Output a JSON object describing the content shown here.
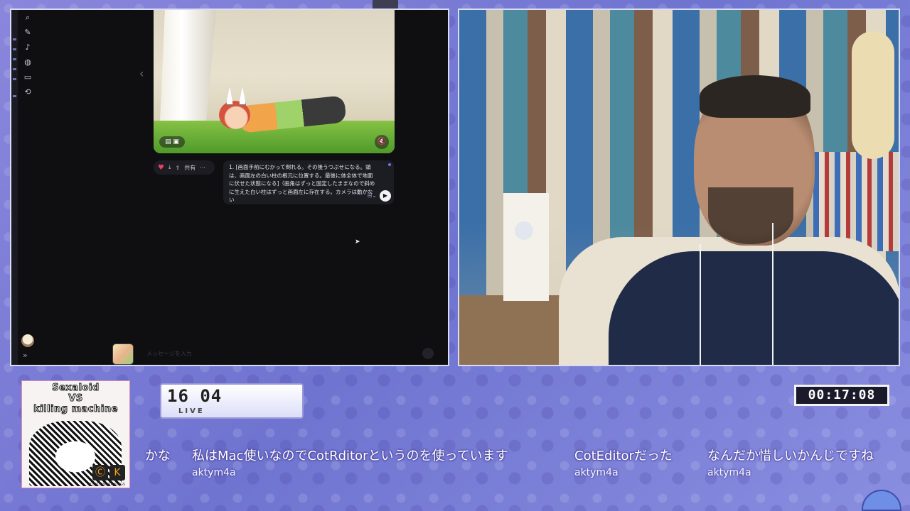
{
  "screen": {
    "rail_icons": [
      "search-icon",
      "edit-icon",
      "audio-icon",
      "globe-icon",
      "folder-icon",
      "history-icon"
    ],
    "rail_glyphs": [
      "⌕",
      "✎",
      "♪",
      "◍",
      "▭",
      "⟲"
    ],
    "prev_arrow": "‹",
    "expand_glyph": "»",
    "action_bar": {
      "heart": "♥",
      "download": "⤓",
      "share_icon": "⇪",
      "share_label": "共有",
      "more": "···"
    },
    "prompt_text": "1. [画面手前にむかって倒れる。その後うつぶせになる。頭は、画面左の白い柱の根元に位置する。最後に体全体で地面に伏せた状態になる]（画角はずっと固定したままなので斜めに生えた白い柱はずっと画面左に存在する。カメラは動かない",
    "prompt_option": "⊟⌄",
    "play_glyph": "▶",
    "input_placeholder": "メッセージを入力",
    "mute_glyph": "🔇",
    "left_ctl_glyph": "▤ ▣",
    "cursor_glyph": "➤"
  },
  "overlay": {
    "cover_title_line1": "Sexaloid",
    "cover_title_line2": "VS",
    "cover_title_line3": "killing machine",
    "cover_credit": "CLOCKWORK KINGS",
    "cover_logo1": "Ⓒ",
    "cover_logo2": "K",
    "live_number": "16 04",
    "live_label": "LIVE",
    "timer": "00:17:08"
  },
  "chat": [
    {
      "text": "かな",
      "user": ""
    },
    {
      "text": "私はMac使いなのでCotRditorというのを使っています",
      "user": "aktym4a"
    },
    {
      "text": "CotEditorだった",
      "user": "aktym4a"
    },
    {
      "text": "なんだか惜しいかんじですね",
      "user": "aktym4a"
    }
  ],
  "colors": {
    "background": "#7d80d6",
    "frame": "#d9dcf5",
    "screen_bg": "#0f0f12",
    "heart": "#e4455f"
  }
}
